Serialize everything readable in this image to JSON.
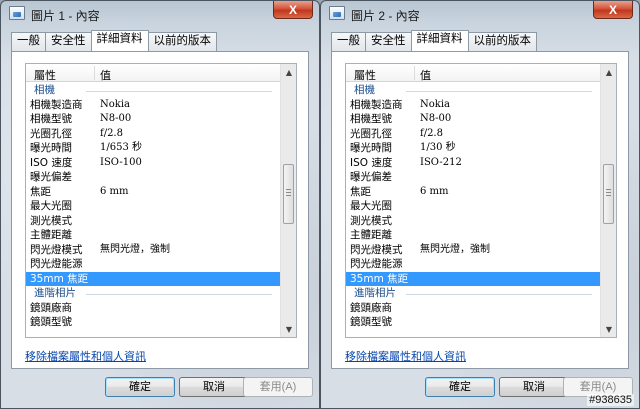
{
  "windows": [
    {
      "title": "圖片 1 - 內容",
      "close_label": "X",
      "tabs": [
        "一般",
        "安全性",
        "詳細資料",
        "以前的版本"
      ],
      "active_tab": 2,
      "columns": {
        "property": "屬性",
        "value": "值"
      },
      "rows": [
        {
          "k": "相機",
          "v": "",
          "group": true
        },
        {
          "k": "相機製造商",
          "v": "Nokia"
        },
        {
          "k": "相機型號",
          "v": "N8-00"
        },
        {
          "k": "光圈孔徑",
          "v": "f/2.8"
        },
        {
          "k": "曝光時間",
          "v": "1/653 秒"
        },
        {
          "k": "ISO 速度",
          "v": "ISO-100"
        },
        {
          "k": "曝光偏差",
          "v": ""
        },
        {
          "k": "焦距",
          "v": "6 mm"
        },
        {
          "k": "最大光圈",
          "v": ""
        },
        {
          "k": "測光模式",
          "v": ""
        },
        {
          "k": "主體距離",
          "v": ""
        },
        {
          "k": "閃光燈模式",
          "v": "無閃光燈，強制"
        },
        {
          "k": "閃光燈能源",
          "v": ""
        },
        {
          "k": "35mm 焦距",
          "v": "",
          "selected": true
        },
        {
          "k": "進階相片",
          "v": "",
          "group": true
        },
        {
          "k": "鏡頭廠商",
          "v": ""
        },
        {
          "k": "鏡頭型號",
          "v": ""
        }
      ],
      "remove_link": "移除檔案屬性和個人資訊",
      "buttons": {
        "ok": "確定",
        "cancel": "取消",
        "apply": "套用(A)"
      }
    },
    {
      "title": "圖片 2 - 內容",
      "close_label": "X",
      "tabs": [
        "一般",
        "安全性",
        "詳細資料",
        "以前的版本"
      ],
      "active_tab": 2,
      "columns": {
        "property": "屬性",
        "value": "值"
      },
      "rows": [
        {
          "k": "相機",
          "v": "",
          "group": true
        },
        {
          "k": "相機製造商",
          "v": "Nokia"
        },
        {
          "k": "相機型號",
          "v": "N8-00"
        },
        {
          "k": "光圈孔徑",
          "v": "f/2.8"
        },
        {
          "k": "曝光時間",
          "v": "1/30 秒"
        },
        {
          "k": "ISO 速度",
          "v": "ISO-212"
        },
        {
          "k": "曝光偏差",
          "v": ""
        },
        {
          "k": "焦距",
          "v": "6 mm"
        },
        {
          "k": "最大光圈",
          "v": ""
        },
        {
          "k": "測光模式",
          "v": ""
        },
        {
          "k": "主體距離",
          "v": ""
        },
        {
          "k": "閃光燈模式",
          "v": "無閃光燈，強制"
        },
        {
          "k": "閃光燈能源",
          "v": ""
        },
        {
          "k": "35mm 焦距",
          "v": "",
          "selected": true
        },
        {
          "k": "進階相片",
          "v": "",
          "group": true
        },
        {
          "k": "鏡頭廠商",
          "v": ""
        },
        {
          "k": "鏡頭型號",
          "v": ""
        }
      ],
      "remove_link": "移除檔案屬性和個人資訊",
      "buttons": {
        "ok": "確定",
        "cancel": "取消",
        "apply": "套用(A)"
      }
    }
  ],
  "watermark": "#938635"
}
